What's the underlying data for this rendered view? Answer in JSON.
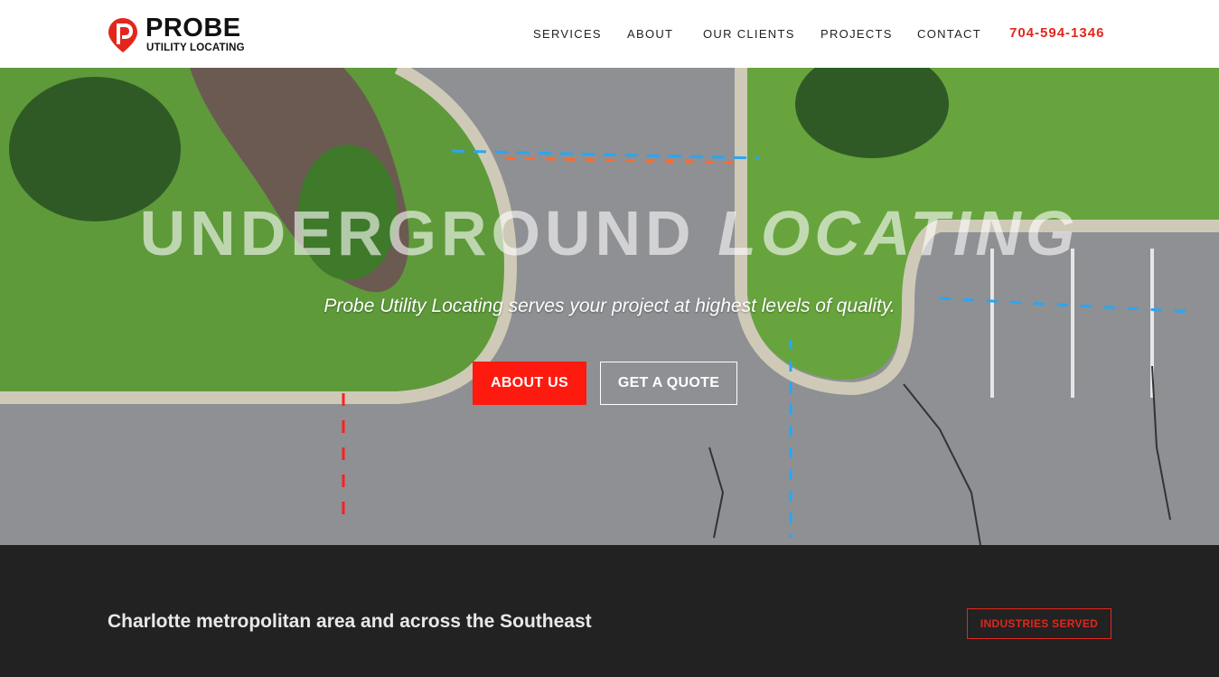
{
  "header": {
    "logo_title": "PROBE",
    "logo_subtitle": "UTILITY LOCATING",
    "logo_letter": "P",
    "brand_color": "#e3261c"
  },
  "nav": {
    "items": [
      {
        "label": "SERVICES"
      },
      {
        "label": "ABOUT"
      },
      {
        "label": "OUR CLIENTS"
      },
      {
        "label": "PROJECTS"
      },
      {
        "label": "CONTACT"
      }
    ],
    "phone": "704-594-1346"
  },
  "hero": {
    "title_main": "UNDERGROUND",
    "title_accent": "LOCATING",
    "subtitle": "Probe Utility Locating serves your project at highest levels of quality.",
    "primary_button": "ABOUT US",
    "secondary_button": "GET A QUOTE",
    "primary_color": "#ff1a0f"
  },
  "band": {
    "text": "Charlotte metropolitan area and across the Southeast",
    "button": "INDUSTRIES SERVED",
    "background": "#222222"
  }
}
